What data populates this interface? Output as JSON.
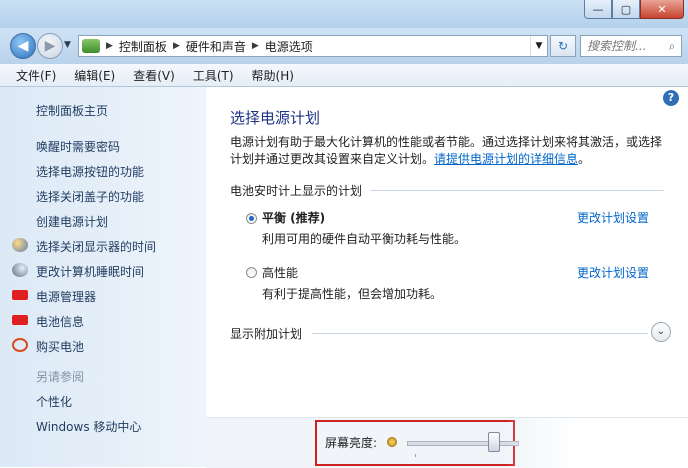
{
  "window": {
    "controls": {
      "minimize": "—",
      "maximize": "▢",
      "close": "✕"
    }
  },
  "nav": {
    "address": [
      "控制面板",
      "硬件和声音",
      "电源选项"
    ],
    "search_placeholder": "搜索控制..."
  },
  "menu": [
    "文件(F)",
    "编辑(E)",
    "查看(V)",
    "工具(T)",
    "帮助(H)"
  ],
  "left_pane": {
    "home": "控制面板主页",
    "links": [
      {
        "label": "唤醒时需要密码"
      },
      {
        "label": "选择电源按钮的功能"
      },
      {
        "label": "选择关闭盖子的功能"
      },
      {
        "label": "创建电源计划"
      },
      {
        "label": "选择关闭显示器的时间",
        "icon": "display-moon-icon"
      },
      {
        "label": "更改计算机睡眠时间",
        "icon": "moon-icon"
      },
      {
        "label": "电源管理器",
        "icon": "battery-icon"
      },
      {
        "label": "电池信息",
        "icon": "battery-icon"
      },
      {
        "label": "购买电池",
        "icon": "globe-icon"
      }
    ],
    "see_also": "另请参阅",
    "see_also_links": [
      "个性化",
      "Windows 移动中心"
    ]
  },
  "main": {
    "title": "选择电源计划",
    "description": "电源计划有助于最大化计算机的性能或者节能。通过选择计划来将其激活，或选择计划并通过更改其设置来自定义计划。",
    "description_link": "请提供电源计划的详细信息",
    "description_end": "。",
    "section_title": "电池安时计上显示的计划",
    "plans": [
      {
        "name": "平衡 (推荐)",
        "desc": "利用可用的硬件自动平衡功耗与性能。",
        "link": "更改计划设置",
        "selected": true
      },
      {
        "name": "高性能",
        "desc": "有利于提高性能，但会增加功耗。",
        "link": "更改计划设置",
        "selected": false
      }
    ],
    "extra_plans": "显示附加计划",
    "brightness_label": "屏幕亮度:",
    "brightness_level": 0.78
  }
}
